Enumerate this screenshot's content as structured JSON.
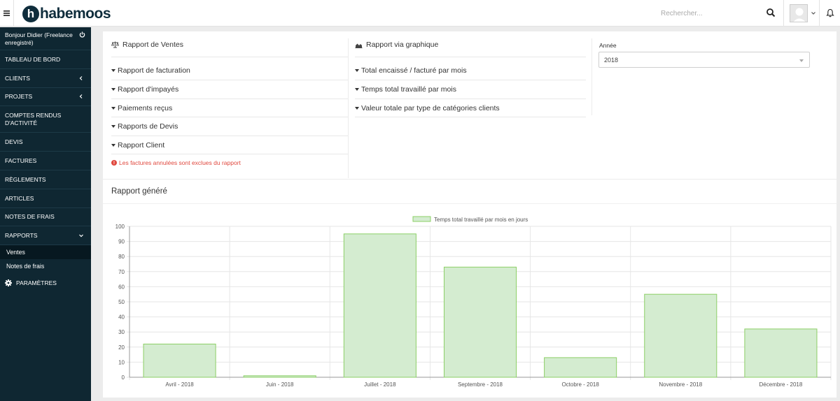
{
  "app": {
    "logo_text": "habemoos",
    "logo_letter": "h",
    "search_placeholder": "Rechercher..."
  },
  "sidebar": {
    "user": "Bonjour Didier (Freelance enregistré)",
    "items": [
      {
        "label": "TABLEAU DE BORD"
      },
      {
        "label": "CLIENTS"
      },
      {
        "label": "PROJETS"
      },
      {
        "label": "COMPTES RENDUS D'ACTIVITÉ"
      },
      {
        "label": "DEVIS"
      },
      {
        "label": "FACTURES"
      },
      {
        "label": "RÈGLEMENTS"
      },
      {
        "label": "ARTICLES"
      },
      {
        "label": "NOTES DE FRAIS"
      },
      {
        "label": "RAPPORTS"
      }
    ],
    "sub_items": [
      {
        "label": "Ventes"
      },
      {
        "label": "Notes de frais"
      }
    ],
    "settings_label": "PARAMÈTRES"
  },
  "reports": {
    "sales_title": "Rapport de Ventes",
    "sales_links": [
      {
        "label": "Rapport de facturation"
      },
      {
        "label": "Rapport d'impayés"
      },
      {
        "label": "Paiements reçus"
      },
      {
        "label": "Rapports de Devis"
      },
      {
        "label": "Rapport Client"
      }
    ],
    "notice": "Les factures annulées sont exclues du rapport",
    "chart_title": "Rapport via graphique",
    "chart_links": [
      {
        "label": "Total encaissé / facturé par mois"
      },
      {
        "label": "Temps total travaillé par mois"
      },
      {
        "label": "Valeur totale par type de catégories clients"
      }
    ],
    "year_label": "Année",
    "year_value": "2018",
    "generated_title": "Rapport généré"
  },
  "colors": {
    "sidebar_bg": "#0f2732",
    "bar_fill": "#d4ecd0",
    "bar_stroke": "#8ccf66"
  },
  "chart_data": {
    "type": "bar",
    "categories": [
      "Avril - 2018",
      "Juin - 2018",
      "Juillet - 2018",
      "Septembre - 2018",
      "Octobre - 2018",
      "Novembre - 2018",
      "Décembre - 2018"
    ],
    "series": [
      {
        "name": "Temps total travaillé par mois en jours",
        "values": [
          22,
          1,
          95,
          73,
          13,
          55,
          32
        ]
      }
    ],
    "ylim": [
      0,
      100
    ],
    "yticks": [
      0,
      10,
      20,
      30,
      40,
      50,
      60,
      70,
      80,
      90,
      100
    ],
    "grid": true,
    "legend": "top-center"
  }
}
